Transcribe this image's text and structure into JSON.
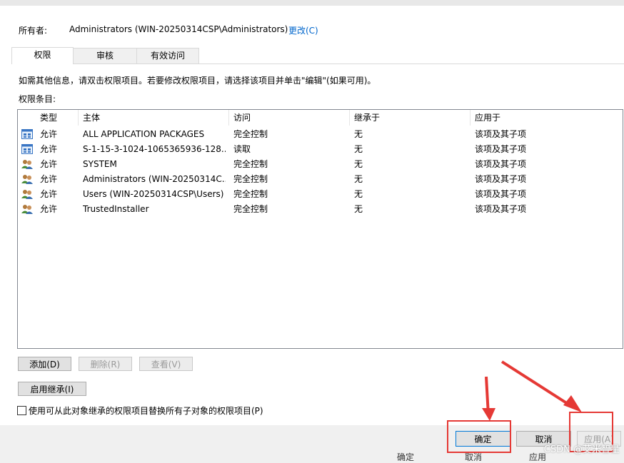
{
  "owner": {
    "label": "所有者:",
    "value": "Administrators (WIN-20250314CSP\\Administrators)",
    "change_link": "更改(C)"
  },
  "tabs": [
    {
      "label": "权限",
      "active": true
    },
    {
      "label": "审核",
      "active": false
    },
    {
      "label": "有效访问",
      "active": false
    }
  ],
  "hint_text": "如需其他信息，请双击权限项目。若要修改权限项目，请选择该项目并单击\"编辑\"(如果可用)。",
  "entries_label": "权限条目:",
  "table": {
    "columns": [
      "类型",
      "主体",
      "访问",
      "继承于",
      "应用于"
    ],
    "rows": [
      {
        "icon": "app-package-icon",
        "type": "允许",
        "principal": "ALL APPLICATION PACKAGES",
        "access": "完全控制",
        "inherited": "无",
        "applies": "该项及其子项"
      },
      {
        "icon": "app-package-icon",
        "type": "允许",
        "principal": "S-1-15-3-1024-1065365936-128...",
        "access": "读取",
        "inherited": "无",
        "applies": "该项及其子项"
      },
      {
        "icon": "users-group-icon",
        "type": "允许",
        "principal": "SYSTEM",
        "access": "完全控制",
        "inherited": "无",
        "applies": "该项及其子项"
      },
      {
        "icon": "users-group-icon",
        "type": "允许",
        "principal": "Administrators (WIN-20250314C...",
        "access": "完全控制",
        "inherited": "无",
        "applies": "该项及其子项"
      },
      {
        "icon": "users-group-icon",
        "type": "允许",
        "principal": "Users (WIN-20250314CSP\\Users)",
        "access": "完全控制",
        "inherited": "无",
        "applies": "该项及其子项"
      },
      {
        "icon": "users-group-icon",
        "type": "允许",
        "principal": "TrustedInstaller",
        "access": "完全控制",
        "inherited": "无",
        "applies": "该项及其子项"
      }
    ]
  },
  "buttons": {
    "add": "添加(D)",
    "remove": "删除(R)",
    "view": "查看(V)",
    "enable_inheritance": "启用继承(I)",
    "ok": "确定",
    "cancel": "取消",
    "apply": "应用(A)"
  },
  "checkbox_label": "使用可从此对象继承的权限项目替换所有子对象的权限项目(P)",
  "behind_window": {
    "ok": "确定",
    "cancel": "取消",
    "apply": "应用"
  },
  "watermark": "CSDN @艾米智星",
  "colors": {
    "highlight": "#e53935",
    "link": "#0066cc"
  }
}
